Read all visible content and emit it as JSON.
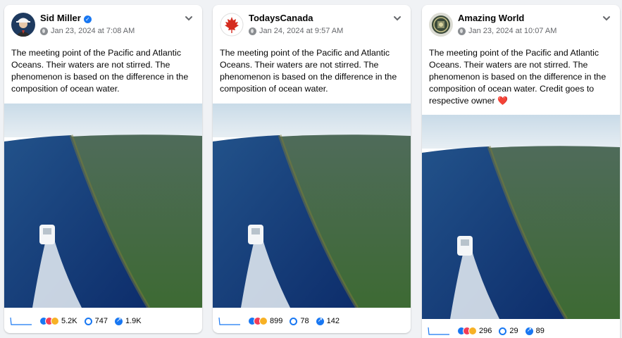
{
  "posts": [
    {
      "author": "Sid Miller",
      "verified": true,
      "timestamp": "Jan 23, 2024 at 7:08 AM",
      "text": "The meeting point of the Pacific and Atlantic Oceans. Their waters are not stirred. The phenomenon is based on the difference in the composition of ocean water.",
      "reactions": "5.2K",
      "comments": "747",
      "shares": "1.9K"
    },
    {
      "author": "TodaysCanada",
      "verified": false,
      "timestamp": "Jan 24, 2024 at 9:57 AM",
      "text": "The meeting point of the Pacific and Atlantic Oceans. Their waters are not stirred. The phenomenon is based on the difference in the composition of ocean water.",
      "reactions": "899",
      "comments": "78",
      "shares": "142"
    },
    {
      "author": "Amazing World",
      "verified": false,
      "timestamp": "Jan 23, 2024 at 10:07 AM",
      "text": "The meeting point of the Pacific and Atlantic Oceans. Their waters are not stirred. The phenomenon is based on the difference in the composition of ocean water. Credit goes to respective owner",
      "emoji": "❤️",
      "reactions": "296",
      "comments": "29",
      "shares": "89"
    }
  ],
  "colors": {
    "accent": "#1877f2",
    "meta": "#65676b",
    "background": "#f0f2f5"
  },
  "icons": [
    "verified-badge-icon",
    "globe-icon",
    "chevron-down-icon",
    "sparkline-icon",
    "reactions-icon",
    "comment-icon",
    "share-icon",
    "heart-emoji"
  ]
}
